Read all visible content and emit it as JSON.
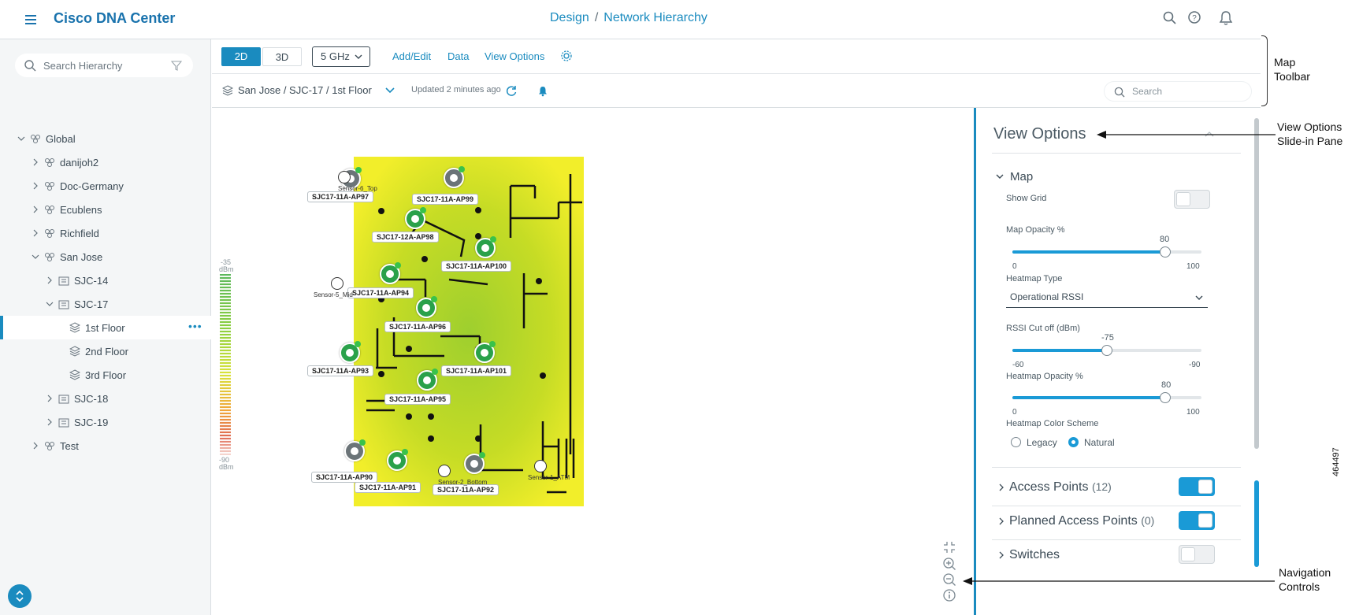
{
  "app": {
    "brand": "Cisco DNA Center",
    "crumb_design": "Design",
    "crumb_sep": "/",
    "crumb_page": "Network Hierarchy"
  },
  "sidebar": {
    "search_placeholder": "Search Hierarchy",
    "items": [
      {
        "label": "Global",
        "level": 0,
        "expanded": true,
        "icon": "globe-icon"
      },
      {
        "label": "danijoh2",
        "level": 1,
        "expanded": false,
        "icon": "area-icon"
      },
      {
        "label": "Doc-Germany",
        "level": 1,
        "expanded": false,
        "icon": "area-icon"
      },
      {
        "label": "Ecublens",
        "level": 1,
        "expanded": false,
        "icon": "area-icon"
      },
      {
        "label": "Richfield",
        "level": 1,
        "expanded": false,
        "icon": "area-icon"
      },
      {
        "label": "San Jose",
        "level": 1,
        "expanded": true,
        "icon": "area-icon"
      },
      {
        "label": "SJC-14",
        "level": 2,
        "expanded": false,
        "icon": "building-icon"
      },
      {
        "label": "SJC-17",
        "level": 2,
        "expanded": true,
        "icon": "building-icon"
      },
      {
        "label": "1st Floor",
        "level": 3,
        "selected": true,
        "icon": "floor-icon",
        "more": "•••"
      },
      {
        "label": "2nd Floor",
        "level": 3,
        "icon": "floor-icon"
      },
      {
        "label": "3rd Floor",
        "level": 3,
        "icon": "floor-icon"
      },
      {
        "label": "SJC-18",
        "level": 2,
        "expanded": false,
        "icon": "building-icon"
      },
      {
        "label": "SJC-19",
        "level": 2,
        "expanded": false,
        "icon": "building-icon"
      },
      {
        "label": "Test",
        "level": 1,
        "expanded": false,
        "icon": "area-icon"
      }
    ]
  },
  "toolbar": {
    "btn_2d": "2D",
    "btn_3d": "3D",
    "band": "5 GHz",
    "add_edit": "Add/Edit",
    "data": "Data",
    "view_options": "View Options"
  },
  "location": {
    "path": "San Jose / SJC-17 / 1st Floor",
    "updated": "Updated 2 minutes ago",
    "search_placeholder": "Search"
  },
  "legend": {
    "top": "-35",
    "bottom": "-90",
    "unit": "dBm"
  },
  "map": {
    "aps": [
      {
        "label": "SJC17-11A-AP97",
        "sensor": "Sensor-6_Top"
      },
      {
        "label": "SJC17-11A-AP99"
      },
      {
        "label": "SJC17-12A-AP98"
      },
      {
        "label": "SJC17-11A-AP100"
      },
      {
        "label": "SJC17-11A-AP94",
        "sensor": "Sensor-5_Mid"
      },
      {
        "label": "SJC17-11A-AP96"
      },
      {
        "label": "SJC17-11A-AP93"
      },
      {
        "label": "SJC17-11A-AP101"
      },
      {
        "label": "SJC17-11A-AP95"
      },
      {
        "label": "SJC17-11A-AP90"
      },
      {
        "label": "SJC17-11A-AP91"
      },
      {
        "label": "SJC17-11A-AP92",
        "sensor": "Sensor-2_Bottom"
      },
      {
        "label": "",
        "sensor": "Sensor-1_ATM"
      }
    ]
  },
  "view_options": {
    "title": "View Options",
    "map_section": "Map",
    "show_grid": {
      "label": "Show Grid",
      "on": false
    },
    "map_opacity": {
      "label": "Map Opacity %",
      "value": "80",
      "min": "0",
      "max": "100",
      "fraction": 0.8
    },
    "heatmap_type": {
      "label": "Heatmap Type",
      "value": "Operational RSSI"
    },
    "rssi_cutoff": {
      "label": "RSSI Cut off (dBm)",
      "value": "-75",
      "min": "-60",
      "max": "-90",
      "fraction": 0.5
    },
    "heatmap_opacity": {
      "label": "Heatmap Opacity %",
      "value": "80",
      "min": "0",
      "max": "100",
      "fraction": 0.8
    },
    "color_scheme": {
      "label": "Heatmap Color Scheme",
      "legacy": "Legacy",
      "natural": "Natural",
      "selected": "Natural"
    },
    "rows": [
      {
        "label": "Access Points",
        "count": "(12)",
        "on": true
      },
      {
        "label": "Planned Access Points",
        "count": "(0)",
        "on": true
      },
      {
        "label": "Switches",
        "count": "",
        "on": false
      }
    ]
  },
  "annotations": {
    "map_toolbar": [
      "Map",
      "Toolbar"
    ],
    "view_options_pane": [
      "View Options",
      "Slide-in Pane"
    ],
    "nav_controls": [
      "Navigation",
      "Controls"
    ],
    "figure_id": "464497"
  }
}
